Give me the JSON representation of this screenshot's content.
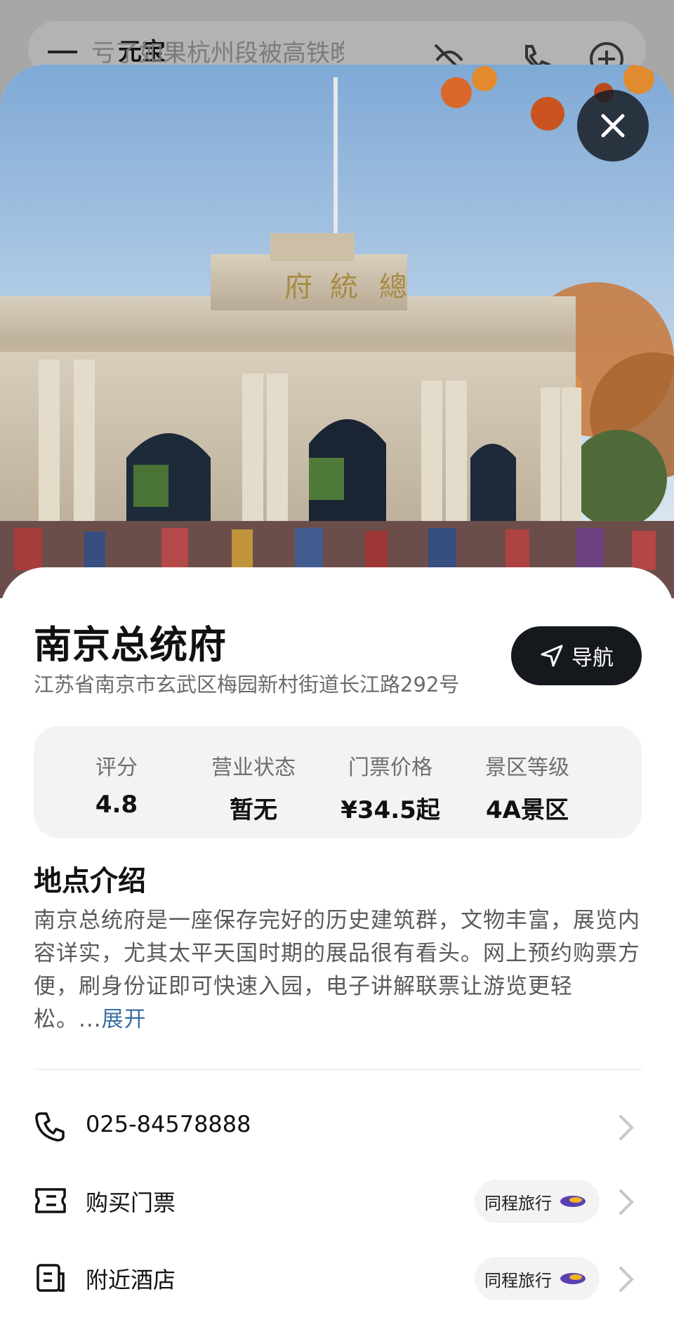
{
  "background_app": {
    "title": "元宝",
    "query": "亏了如果杭州段被高铁晚广"
  },
  "place": {
    "name": "南京总统府",
    "address": "江苏省南京市玄武区梅园新村街道长江路292号",
    "nav_label": "导航",
    "hero_sign": [
      "府",
      "統",
      "總"
    ]
  },
  "stats": [
    {
      "label": "评分",
      "value": "4.8"
    },
    {
      "label": "营业状态",
      "value": "暂无"
    },
    {
      "label": "门票价格",
      "value": "¥34.5起"
    },
    {
      "label": "景区等级",
      "value": "4A景区"
    }
  ],
  "intro": {
    "title": "地点介绍",
    "text": "南京总统府是一座保存完好的历史建筑群，文物丰富，展览内容详实，尤其太平天国时期的展品很有看头。网上预约购票方便，刷身份证即可快速入园，电子讲解联票让游览更轻松。...",
    "more": "展开"
  },
  "actions": {
    "phone": "025-84578888",
    "tickets": {
      "label": "购买门票",
      "partner": "同程旅行"
    },
    "hotels": {
      "label": "附近酒店",
      "partner": "同程旅行"
    }
  },
  "colors": {
    "accent": "#3d6fa6",
    "dark": "#15181d"
  }
}
